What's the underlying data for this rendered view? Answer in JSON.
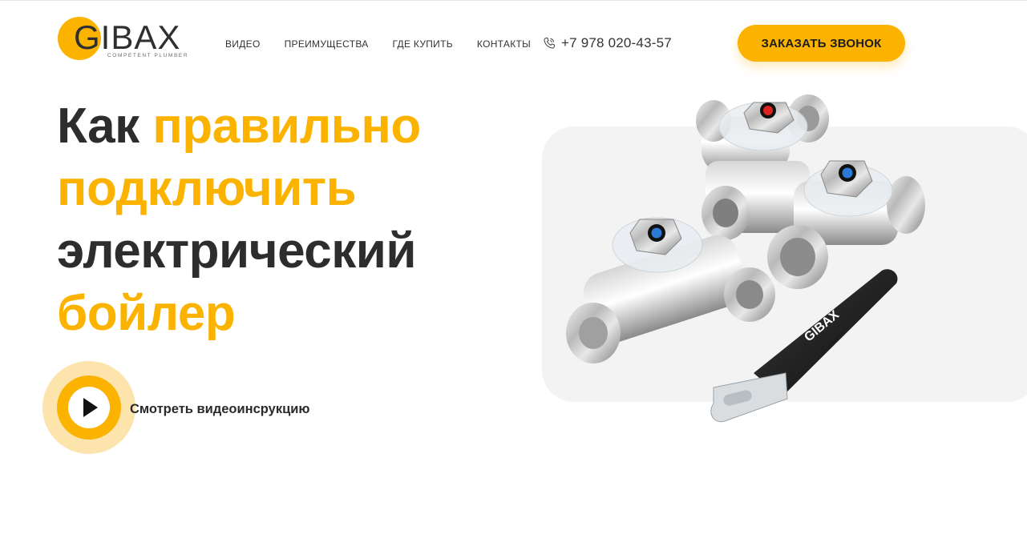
{
  "header": {
    "logo": {
      "word": "GIBAX",
      "tagline": "COMPETENT PLUMBER"
    },
    "nav": [
      {
        "label": "ВИДЕО"
      },
      {
        "label": "ПРЕИМУЩЕСТВА"
      },
      {
        "label": "ГДЕ КУПИТЬ"
      },
      {
        "label": "КОНТАКТЫ"
      }
    ],
    "phone": "+7 978 020-43-57",
    "cta_label": "ЗАКАЗАТЬ ЗВОНОК"
  },
  "hero": {
    "title_lines": [
      {
        "dark": "Как ",
        "accent": "правильно"
      },
      {
        "accent": "подключить"
      },
      {
        "dark": "электрический"
      },
      {
        "accent": "бойлер"
      }
    ],
    "video_label": "Смотреть видеоинсрукцию"
  },
  "product": {
    "handle_brand": "GIBAX"
  },
  "colors": {
    "accent": "#fbb300",
    "accent_light": "#fde4ad",
    "text_dark": "#2d2d2d",
    "panel_bg": "#f3f3f3"
  },
  "icons": {
    "phone": "phone-icon",
    "play": "play-icon"
  }
}
